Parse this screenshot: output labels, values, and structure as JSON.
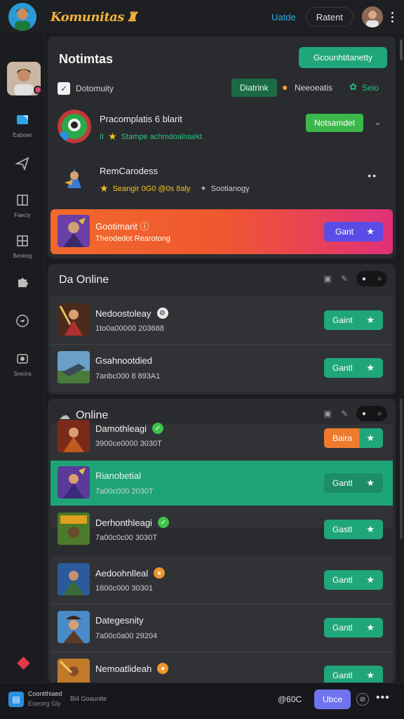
{
  "topbar": {
    "brand": "Komunitas",
    "link": "Uatde",
    "pill": "Ratent"
  },
  "sidebar": {
    "items": [
      {
        "label": "Eaboan",
        "icon": "chat-icon"
      },
      {
        "label": "",
        "icon": "paper-plane-icon"
      },
      {
        "label": "Faeciy",
        "icon": "book-icon"
      },
      {
        "label": "Bestiog",
        "icon": "grid-icon"
      },
      {
        "label": "",
        "icon": "puzzle-icon"
      },
      {
        "label": "",
        "icon": "compass-icon"
      },
      {
        "label": "Srecira",
        "icon": "camera-icon"
      }
    ]
  },
  "notifications": {
    "title": "Notimtas",
    "action": "Gcounhtitanetty",
    "community": {
      "label": "Dotomuity",
      "chip": "Diatrink",
      "item": "Neeoeatis",
      "status": "Seio"
    },
    "items": [
      {
        "title": "Pracomplatis 6 blarit",
        "sub": "Stampe achmdoalnaekt",
        "sub_prefix": "II",
        "button": "Notsamdet"
      },
      {
        "title": "RemCarodess",
        "sub": "Seangir 0G0 @0s 8aly",
        "sub2": "Sootianogy"
      }
    ],
    "promo": {
      "title": "Gootimarit",
      "sub": "Theodedot Rearotong",
      "button": "Gant"
    }
  },
  "section1": {
    "title": "Da Online",
    "games": [
      {
        "title": "Nedoostoleay",
        "sub": "1to0a00000 203688",
        "button": "Gaint"
      },
      {
        "title": "Gsahnootdied",
        "sub": "7anbc000 8 893A1",
        "button": "Gantl"
      }
    ]
  },
  "section2": {
    "title": "Online",
    "games": [
      {
        "title": "Damothleagi",
        "sub": "3900ce0000 3030T",
        "button": "Baira",
        "badge": "check"
      },
      {
        "title": "Rianobetial",
        "sub": "7a00c000 2030T",
        "button": "Gantl"
      },
      {
        "title": "Derhonthleagi",
        "sub": "7a00c0c00 3030T",
        "button": "Gastl",
        "badge": "check"
      },
      {
        "title": "Aedoohnlleal",
        "sub": "1800c000 30301",
        "button": "Gantl",
        "badge": "coin"
      },
      {
        "title": "Dategesnity",
        "sub": "7a00c0a00 29204",
        "button": "Gantl"
      },
      {
        "title": "Nemoatlideah",
        "sub": "",
        "button": "Gantl",
        "badge": "coin"
      }
    ]
  },
  "bottombar": {
    "title": "Coontthiaed",
    "sub": "Eseoirg Gly",
    "meta": "Bl4 Goaunite",
    "count": "@60C",
    "button": "Ubce"
  },
  "colors": {
    "accent_green": "#1fa67a",
    "promo_orange": "#f16a2c",
    "promo_pink": "#e0307a",
    "brand_gold": "#f3b23c",
    "button_blue": "#5a4de6"
  }
}
